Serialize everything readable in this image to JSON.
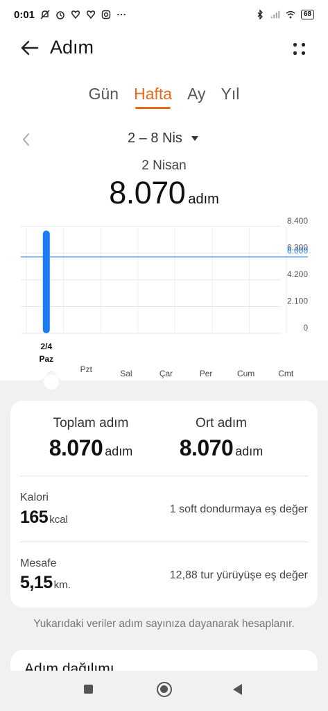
{
  "status_bar": {
    "time": "0:01",
    "battery": "68",
    "icons_left": [
      "mute-icon",
      "alarm-icon",
      "health-icon",
      "health-icon",
      "instagram-icon",
      "more-dots-icon"
    ],
    "icons_right": [
      "bluetooth-icon",
      "signal-icon",
      "wifi-icon",
      "battery-icon"
    ]
  },
  "header": {
    "title": "Adım"
  },
  "tabs": [
    {
      "label": "Gün",
      "active": false
    },
    {
      "label": "Hafta",
      "active": true
    },
    {
      "label": "Ay",
      "active": false
    },
    {
      "label": "Yıl",
      "active": false
    }
  ],
  "period": {
    "label": "2 – 8 Nis"
  },
  "selected_day": {
    "date": "2 Nisan",
    "steps": "8.070",
    "unit": "adım"
  },
  "chart_data": {
    "type": "bar",
    "categories": [
      "Paz",
      "Pzt",
      "Sal",
      "Çar",
      "Per",
      "Cum",
      "Cmt"
    ],
    "selected_date_label": "2/4",
    "values": [
      8070,
      0,
      0,
      0,
      0,
      0,
      0
    ],
    "ylim": [
      0,
      8400
    ],
    "y_ticks": [
      "8.400",
      "6.300",
      "4.200",
      "2.100",
      "0"
    ],
    "y_tick_values": [
      8400,
      6300,
      4200,
      2100,
      0
    ],
    "goal_line": {
      "value": 6000,
      "label": "6.000"
    },
    "bar_color": "#1a7cf2",
    "goal_color": "#1a7cf2",
    "grid": true
  },
  "summary": {
    "total_label": "Toplam adım",
    "total_value": "8.070",
    "total_unit": "adım",
    "avg_label": "Ort adım",
    "avg_value": "8.070",
    "avg_unit": "adım",
    "calorie_label": "Kalori",
    "calorie_value": "165",
    "calorie_unit": "kcal",
    "calorie_equiv": "1 soft dondurmaya eş değer",
    "distance_label": "Mesafe",
    "distance_value": "5,15",
    "distance_unit": "km.",
    "distance_equiv": "12,88 tur yürüyüşe eş değer"
  },
  "footnote": "Yukarıdaki veriler adım sayınıza dayanarak hesaplanır.",
  "distribution": {
    "title": "Adım dağılımı"
  },
  "colors": {
    "accent": "#e86a1d",
    "bar": "#1a7cf2",
    "background_grey": "#f1f1f1"
  }
}
